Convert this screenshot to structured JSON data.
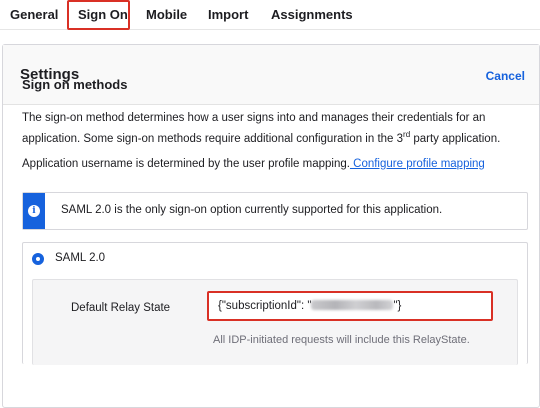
{
  "tabs": [
    {
      "label": "General"
    },
    {
      "label": "Sign On"
    },
    {
      "label": "Mobile"
    },
    {
      "label": "Import"
    },
    {
      "label": "Assignments"
    }
  ],
  "settings": {
    "title": "Settings",
    "cancel_label": "Cancel"
  },
  "sign_on_methods": {
    "title": "Sign on methods",
    "description_part1": "The sign-on method determines how a user signs into and manages their credentials for an application. Some sign-on methods require additional configuration in the 3",
    "description_sup": "rd",
    "description_part2": " party application.",
    "username_text": "Application username is determined by the user profile mapping.",
    "username_link": " Configure profile mapping"
  },
  "info_banner": {
    "icon": "info-icon",
    "text": "SAML 2.0 is the only sign-on option currently supported for this application."
  },
  "saml": {
    "option_label": "SAML 2.0",
    "selected": true,
    "relay_state_label": "Default Relay State",
    "relay_state_value_prefix": "{\"subscriptionId\": \"",
    "relay_state_value_suffix": "\"}",
    "relay_state_help": "All IDP-initiated requests will include this RelayState."
  },
  "colors": {
    "accent": "#1662dd",
    "highlight_outline": "#d93025"
  }
}
